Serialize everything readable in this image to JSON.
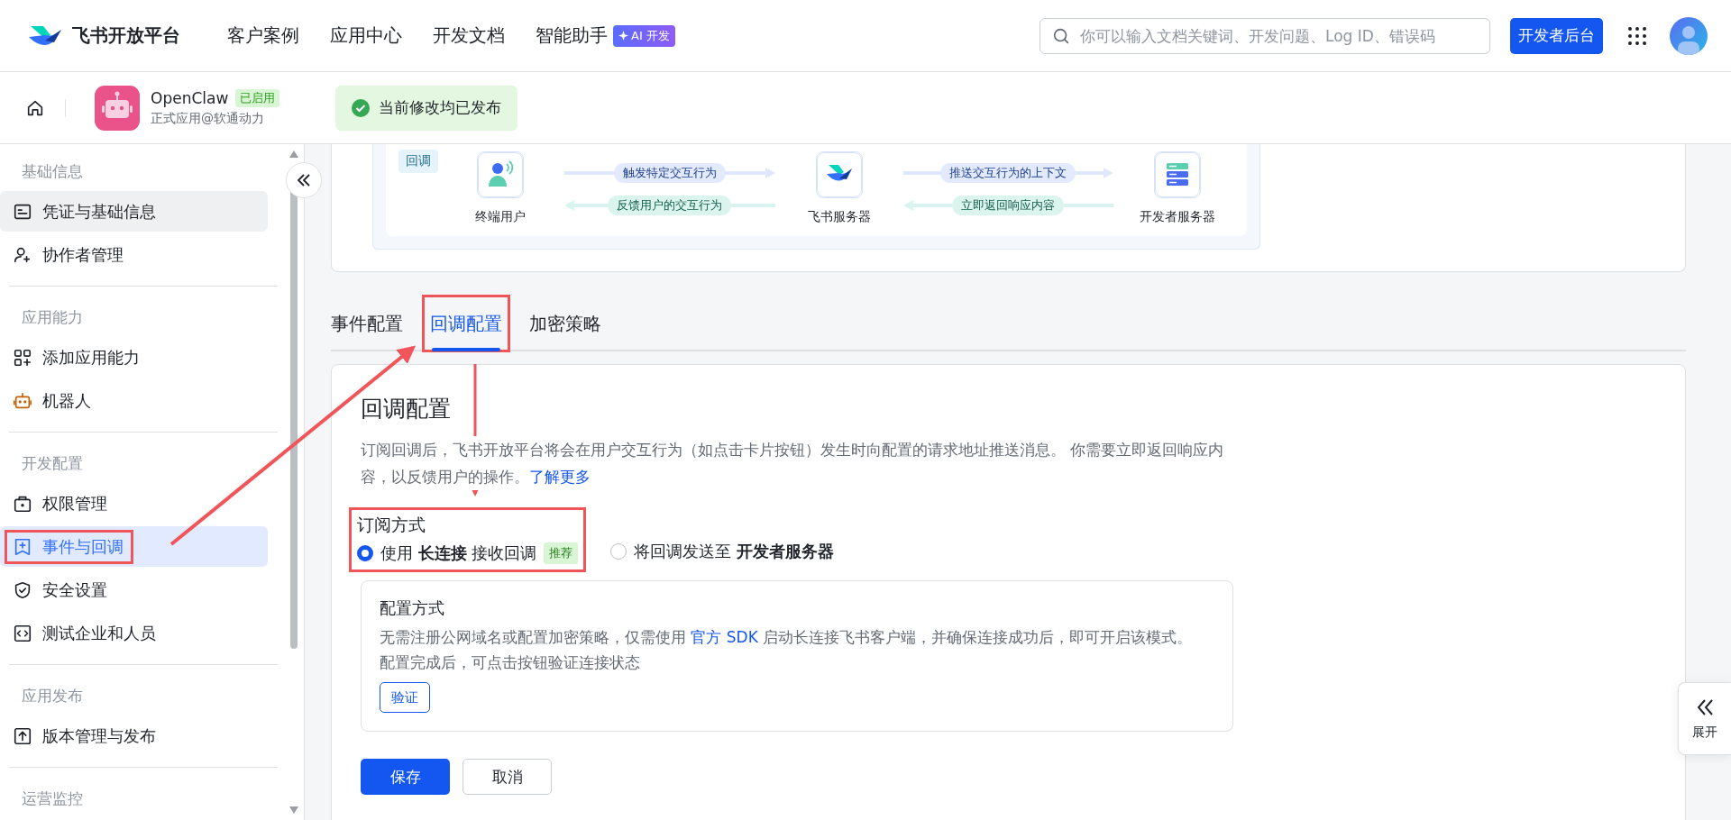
{
  "header": {
    "logo": "飞书开放平台",
    "nav": [
      {
        "label": "客户案例"
      },
      {
        "label": "应用中心"
      },
      {
        "label": "开发文档"
      },
      {
        "label": "智能助手",
        "badge": "AI 开发"
      }
    ],
    "search": {
      "placeholder": "你可以输入文档关键词、开发问题、Log ID、错误码"
    },
    "console_button": "开发者后台"
  },
  "app_bar": {
    "name": "OpenClaw",
    "status": "已启用",
    "subtitle": "正式应用@软通动力",
    "notice": "当前修改均已发布"
  },
  "sidebar": {
    "sections": [
      {
        "title": "基础信息",
        "items": [
          {
            "label": "凭证与基础信息",
            "selected": false,
            "hovered": true,
            "annotated": false
          },
          {
            "label": "协作者管理",
            "selected": false,
            "hovered": false,
            "annotated": false
          }
        ]
      },
      {
        "title": "应用能力",
        "items": [
          {
            "label": "添加应用能力",
            "selected": false,
            "hovered": false,
            "annotated": false
          },
          {
            "label": "机器人",
            "selected": false,
            "hovered": false,
            "annotated": false
          }
        ]
      },
      {
        "title": "开发配置",
        "items": [
          {
            "label": "权限管理",
            "selected": false,
            "hovered": false,
            "annotated": false
          },
          {
            "label": "事件与回调",
            "selected": true,
            "hovered": false,
            "annotated": true
          },
          {
            "label": "安全设置",
            "selected": false,
            "hovered": false,
            "annotated": false
          },
          {
            "label": "测试企业和人员",
            "selected": false,
            "hovered": false,
            "annotated": false
          }
        ]
      },
      {
        "title": "应用发布",
        "items": [
          {
            "label": "版本管理与发布",
            "selected": false,
            "hovered": false,
            "annotated": false
          }
        ]
      },
      {
        "title": "运营监控"
      }
    ]
  },
  "diagram": {
    "tag": "回调",
    "nodes": [
      {
        "label": "终端用户"
      },
      {
        "label": "飞书服务器"
      },
      {
        "label": "开发者服务器"
      }
    ],
    "flows": [
      {
        "forward": "触发特定交互行为",
        "back": "反馈用户的交互行为"
      },
      {
        "forward": "推送交互行为的上下文",
        "back": "立即返回响应内容"
      }
    ]
  },
  "tabs": [
    {
      "label": "事件配置",
      "selected": false,
      "annotated": false
    },
    {
      "label": "回调配置",
      "selected": true,
      "annotated": true
    },
    {
      "label": "加密策略",
      "selected": false,
      "annotated": false
    }
  ],
  "callback": {
    "title": "回调配置",
    "description": "订阅回调后，飞书开放平台将会在用户交互行为（如点击卡片按钮）发生时向配置的请求地址推送消息。 你需要立即返回响应内容，以反馈用户的操作。",
    "link": "了解更多",
    "subscription": {
      "label": "订阅方式",
      "annotated": true,
      "options": [
        {
          "label": "使用 **长连接** 接收回调",
          "badge": "推荐",
          "selected": true
        },
        {
          "label": "将回调发送至 **开发者服务器**",
          "selected": false
        }
      ]
    },
    "config": {
      "title": "配置方式",
      "text_before": "无需注册公网域名或配置加密策略，仅需使用 ",
      "link": "官方 SDK",
      "text_after": " 启动长连接飞书客户端，并确保连接成功后，即可开启该模式。",
      "text_line2": "配置完成后，可点击按钮验证连接状态",
      "verify_button": "验证"
    },
    "buttons": [
      {
        "label": "保存",
        "kind": "primary"
      },
      {
        "label": "取消",
        "kind": "secondary"
      }
    ]
  },
  "expand_button": "展开"
}
